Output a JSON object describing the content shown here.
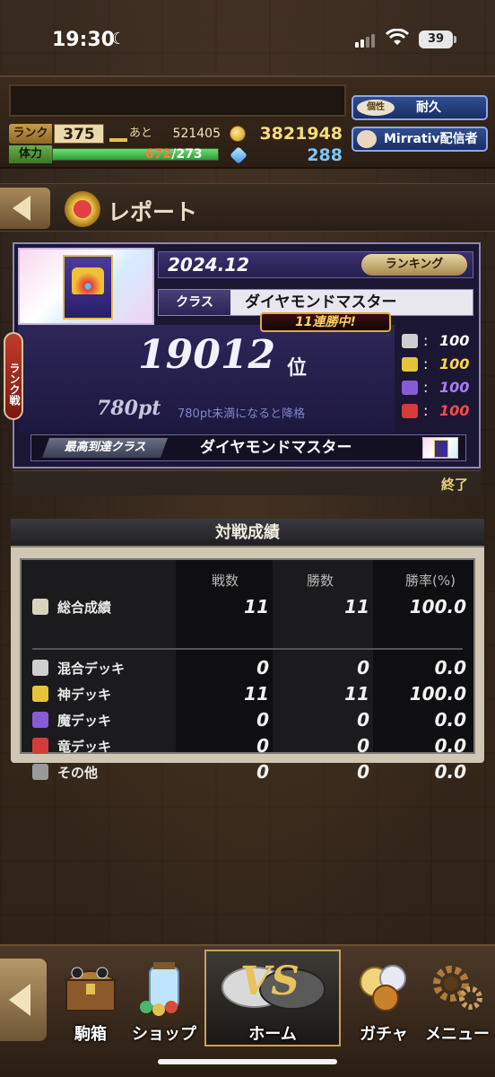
{
  "status_bar": {
    "time": "19:30",
    "battery": "39"
  },
  "header": {
    "rank_label": "ランク",
    "rank_value": "375",
    "exp_label": "あと",
    "exp_value": "521405",
    "stamina_label": "体力",
    "stamina_current": "672",
    "stamina_sep_max": "/273",
    "stamina_fill": 1.0,
    "coins": "3821948",
    "gems": "288",
    "trait_tag": "個性",
    "trait_value": "耐久",
    "mirrativ": "Mirrativ配信者"
  },
  "title_bar": {
    "title": "レポート"
  },
  "report": {
    "date": "2024.12",
    "ranking_button": "ランキング",
    "class_label": "クラス",
    "class_value": "ダイヤモンドマスター",
    "streak": "11連勝中!",
    "rank_tab": "ランク戦",
    "position": "19012",
    "position_suffix": "位",
    "points": "780pt",
    "points_note": "780pt未満になると降格",
    "decks": [
      {
        "icon": "mixed-deck-icon",
        "value": "100",
        "color": "#ffffff",
        "icon_color": "#cfcfcf"
      },
      {
        "icon": "god-deck-icon",
        "value": "100",
        "color": "#ffd64a",
        "icon_color": "#e6c43a"
      },
      {
        "icon": "demon-deck-icon",
        "value": "100",
        "color": "#a97cff",
        "icon_color": "#8a5ad6"
      },
      {
        "icon": "dragon-deck-icon",
        "value": "100",
        "color": "#ff4a4a",
        "icon_color": "#d83a3a"
      }
    ],
    "best_label": "最高到達クラス",
    "best_value": "ダイヤモンドマスター",
    "end_label": "終了"
  },
  "record": {
    "title": "対戦成績",
    "headers": [
      "戦数",
      "勝数",
      "勝率(%)"
    ],
    "total": {
      "label": "総合成績",
      "battles": "11",
      "wins": "11",
      "rate": "100.0"
    },
    "rows": [
      {
        "label": "混合デッキ",
        "icon": "mixed-deck-icon",
        "battles": "0",
        "wins": "0",
        "rate": "0.0"
      },
      {
        "label": "神デッキ",
        "icon": "god-deck-icon",
        "battles": "11",
        "wins": "11",
        "rate": "100.0"
      },
      {
        "label": "魔デッキ",
        "icon": "demon-deck-icon",
        "battles": "0",
        "wins": "0",
        "rate": "0.0"
      },
      {
        "label": "竜デッキ",
        "icon": "dragon-deck-icon",
        "battles": "0",
        "wins": "0",
        "rate": "0.0"
      },
      {
        "label": "その他",
        "icon": "other-deck-icon",
        "battles": "0",
        "wins": "0",
        "rate": "0.0"
      }
    ]
  },
  "nav": {
    "items": [
      "駒箱",
      "ショップ",
      "ホーム",
      "ガチャ",
      "メニュー"
    ],
    "vs": "VS"
  }
}
